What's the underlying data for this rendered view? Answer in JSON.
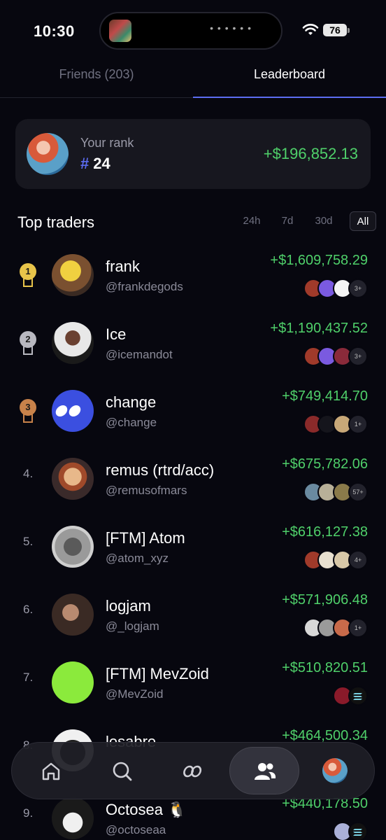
{
  "status_bar": {
    "time": "10:30",
    "battery": "76"
  },
  "tabs": [
    {
      "label": "Friends (203)"
    },
    {
      "label": "Leaderboard"
    }
  ],
  "your_rank": {
    "label": "Your rank",
    "hash": "#",
    "rank": "24",
    "pnl": "+$196,852.13"
  },
  "section": {
    "title": "Top traders",
    "filters": [
      "24h",
      "7d",
      "30d",
      "All"
    ],
    "selected_filter": "All"
  },
  "traders": [
    {
      "rank": "1",
      "name": "frank",
      "handle": "@frankdegods",
      "pnl": "+$1,609,758.29",
      "more": "3+"
    },
    {
      "rank": "2",
      "name": "Ice",
      "handle": "@icemandot",
      "pnl": "+$1,190,437.52",
      "more": "3+"
    },
    {
      "rank": "3",
      "name": "change",
      "handle": "@change",
      "pnl": "+$749,414.70",
      "more": "1+"
    },
    {
      "rank": "4.",
      "name": "remus (rtrd/acc)",
      "handle": "@remusofmars",
      "pnl": "+$675,782.06",
      "more": "57+"
    },
    {
      "rank": "5.",
      "name": "[FTM] Atom",
      "handle": "@atom_xyz",
      "pnl": "+$616,127.38",
      "more": "4+"
    },
    {
      "rank": "6.",
      "name": "logjam",
      "handle": "@_logjam",
      "pnl": "+$571,906.48",
      "more": "1+"
    },
    {
      "rank": "7.",
      "name": "[FTM] MevZoid",
      "handle": "@MevZoid",
      "pnl": "+$510,820.51",
      "more": ""
    },
    {
      "rank": "8.",
      "name": "lesabre",
      "handle": "",
      "pnl": "+$464,500.34",
      "more": ""
    },
    {
      "rank": "9.",
      "name": "Octosea 🐧",
      "handle": "@octoseaa",
      "pnl": "+$440,178.50",
      "more": ""
    }
  ],
  "colors": {
    "accent": "#5b6cf0",
    "positive": "#4fd06a",
    "gold": "#e8c44a",
    "silver": "#b8b8c0",
    "bronze": "#c8824a"
  },
  "nav": [
    "home-icon",
    "search-icon",
    "change-logo-icon",
    "friends-icon",
    "profile-avatar"
  ]
}
